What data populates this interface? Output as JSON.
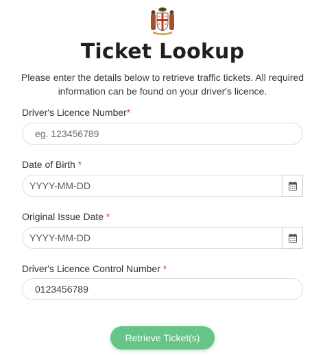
{
  "page": {
    "title": "Ticket Lookup",
    "subtitle": "Please enter the details below to retrieve traffic tickets. All required information can be found on your driver's licence.",
    "required_marker": "*"
  },
  "form": {
    "licence_number": {
      "label": "Driver's Licence Number",
      "placeholder": "eg. 123456789"
    },
    "date_of_birth": {
      "label": "Date of Birth",
      "placeholder": "YYYY-MM-DD"
    },
    "original_issue_date": {
      "label": "Original Issue Date",
      "placeholder": "YYYY-MM-DD"
    },
    "control_number": {
      "label": "Driver's Licence Control Number",
      "value": "0123456789"
    },
    "submit_label": "Retrieve Ticket(s)"
  },
  "icons": {
    "crest": "coat-of-arms-icon",
    "calendar": "calendar-icon"
  },
  "colors": {
    "accent": "#66c487",
    "required": "#e0313b"
  }
}
